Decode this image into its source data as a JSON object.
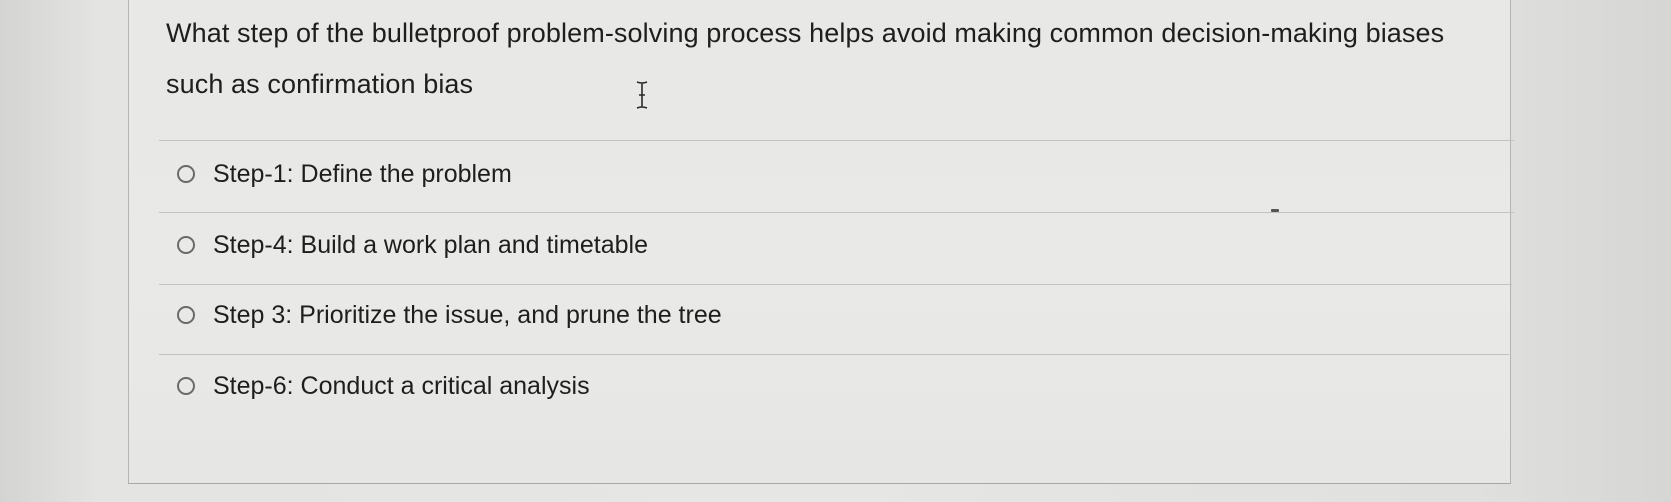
{
  "question": {
    "text": "What step of the bulletproof problem-solving process helps avoid making common decision-making biases such as confirmation bias"
  },
  "options": [
    {
      "label": "Step-1: Define the problem",
      "selected": false
    },
    {
      "label": "Step-4: Build a work plan and timetable",
      "selected": false
    },
    {
      "label": "Step 3: Prioritize the issue, and prune the tree",
      "selected": false
    },
    {
      "label": "Step-6: Conduct a critical analysis",
      "selected": false
    }
  ],
  "colors": {
    "background": "#e6e6e4",
    "text": "#1e1e1e",
    "radio_border": "#6a6a6a",
    "divider": "#c2c2c0"
  },
  "icons": {
    "cursor": "i-beam-cursor-icon",
    "radio": "radio-unchecked-icon"
  }
}
